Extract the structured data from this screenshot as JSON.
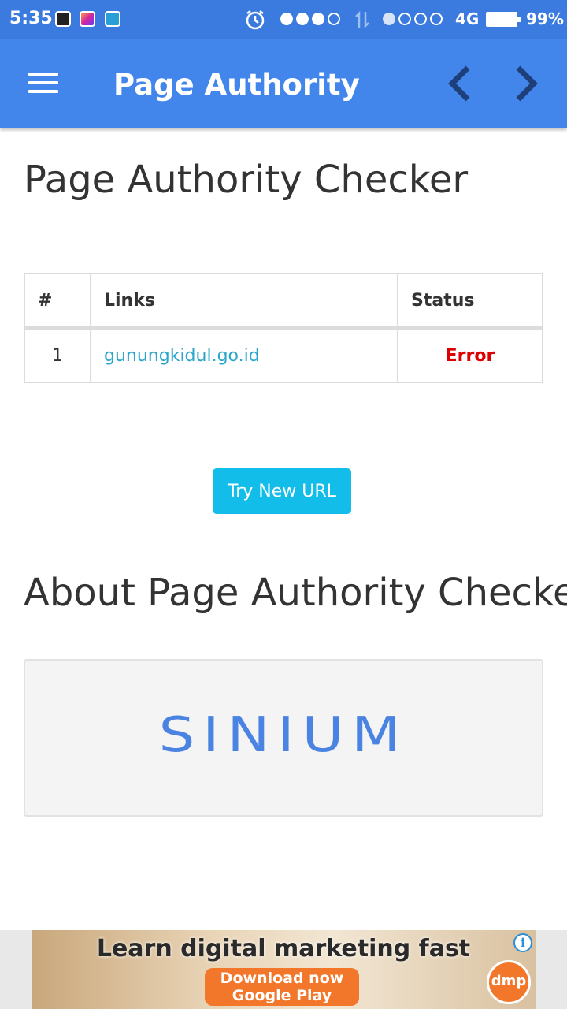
{
  "status_bar": {
    "time": "5:35",
    "network": "4G",
    "battery": "99%"
  },
  "app_bar": {
    "title": "Page Authority",
    "menu_icon": "hamburger-menu-icon",
    "back_icon": "chevron-left-icon",
    "forward_icon": "chevron-right-icon"
  },
  "main": {
    "heading": "Page Authority Checker",
    "table": {
      "headers": [
        "#",
        "Links",
        "Status"
      ],
      "rows": [
        {
          "num": "1",
          "link": "gunungkidul.go.id",
          "status": "Error"
        }
      ]
    },
    "try_button": "Try New URL",
    "about_heading": "About Page Authority Checker",
    "logo_text": "SINIUM"
  },
  "ad": {
    "headline": "Learn digital marketing fast",
    "cta_line1": "Download now",
    "cta_line2": "Google Play",
    "brand": "dmp"
  },
  "colors": {
    "app_bar": "#4286ec",
    "status_bar": "#3b7be0",
    "link": "#2ba6cb",
    "error": "#dd0000",
    "button": "#13bdea",
    "logo": "#4a83e2"
  }
}
